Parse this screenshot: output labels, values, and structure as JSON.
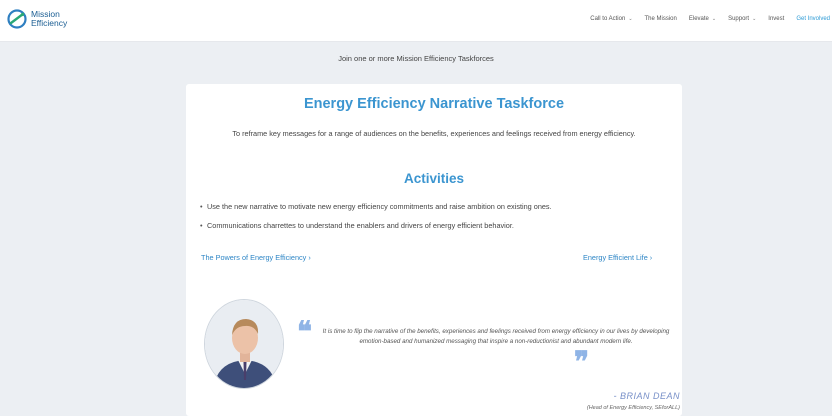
{
  "brand": {
    "line1": "Mission",
    "line2": "Efficiency",
    "color": "#1b5e93"
  },
  "nav": {
    "items": [
      {
        "label": "Call to Action",
        "dropdown": true
      },
      {
        "label": "The Mission",
        "dropdown": false
      },
      {
        "label": "Elevate",
        "dropdown": true
      },
      {
        "label": "Support",
        "dropdown": true
      },
      {
        "label": "Invest",
        "dropdown": false
      },
      {
        "label": "Get Involved",
        "dropdown": false
      }
    ],
    "chevron": "⌄"
  },
  "join_text": "Join one or more Mission Efficiency Taskforces",
  "card": {
    "title": "Energy Efficiency Narrative Taskforce",
    "description": "To reframe key messages for a range of audiences on the benefits, experiences and feelings received from energy efficiency.",
    "activities_title": "Activities",
    "bullets": [
      "Use the new narrative to motivate new energy efficiency commitments and raise ambition on existing ones.",
      "Communications charrettes to understand the enablers and drivers of energy efficient behavior."
    ],
    "link_left": "The Powers of Energy Efficiency ›",
    "link_right": "Energy Efficient Life ›"
  },
  "testimonial": {
    "quote": "It is time to flip the narrative of the benefits, experiences and feelings received from energy efficiency in our lives by developing emotion-based and humanized messaging that inspire a non-reductionist and abundant modern life.",
    "author": "- BRIAN DEAN",
    "role": "(Head of Energy Efficiency, SEforALL)",
    "quote_mark_open": "❝",
    "quote_mark_close": "❞"
  },
  "colors": {
    "accent": "#3b95d0",
    "link": "#2e86c6",
    "quote_mark": "#8fb4e6",
    "highlight": "#2e9bd6",
    "background": "#eceff3"
  },
  "icons": {
    "logo": "mission-efficiency-logo-icon",
    "avatar": "person-avatar"
  }
}
